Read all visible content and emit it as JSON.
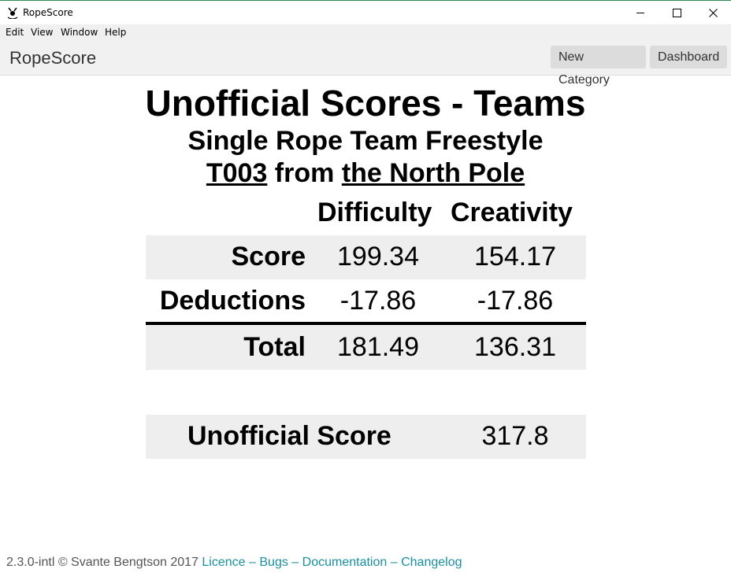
{
  "window": {
    "title": "RopeScore",
    "icon": "jump-rope-app-icon"
  },
  "menu": {
    "items": [
      "Edit",
      "View",
      "Window",
      "Help"
    ]
  },
  "navbar": {
    "brand": "RopeScore",
    "buttons": [
      "New Category",
      "Dashboard"
    ]
  },
  "page": {
    "title": "Unofficial Scores - Teams",
    "event": "Single Rope Team Freestyle",
    "team_id": "T003",
    "from_word": "from",
    "team_name": "the North Pole"
  },
  "table": {
    "columns": [
      "Difficulty",
      "Creativity"
    ],
    "rows": [
      {
        "label": "Score",
        "values": [
          "199.34",
          "154.17"
        ]
      },
      {
        "label": "Deductions",
        "values": [
          "-17.86",
          "-17.86"
        ]
      },
      {
        "label": "Total",
        "values": [
          "181.49",
          "136.31"
        ]
      }
    ]
  },
  "result": {
    "label": "Unofficial Score",
    "value": "317.8"
  },
  "footer": {
    "version": "2.3.0-intl © Svante Bengtson 2017",
    "links": [
      "Licence",
      "Bugs",
      "Documentation",
      "Changelog"
    ],
    "separator": "–"
  },
  "colors": {
    "link": "#1a8fa0",
    "row_shade": "#eeeeee",
    "navbar_bg": "#f1f1f1"
  }
}
